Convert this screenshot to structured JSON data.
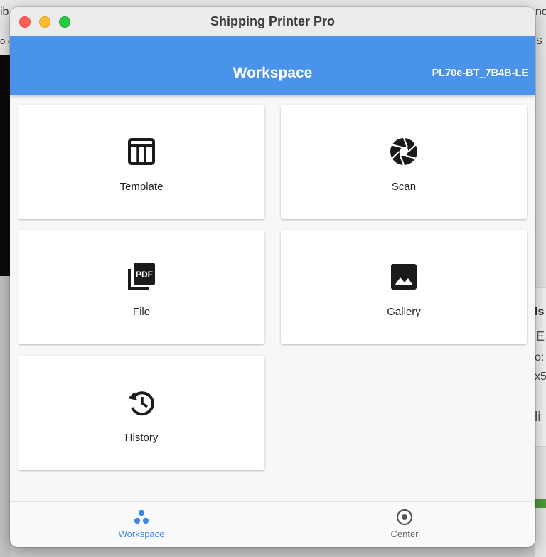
{
  "window": {
    "title": "Shipping Printer Pro"
  },
  "appbar": {
    "title": "Workspace",
    "device_name": "PL70e-BT_7B4B-LE"
  },
  "tiles": [
    {
      "label": "Template",
      "icon": "template-icon"
    },
    {
      "label": "Scan",
      "icon": "camera-shutter-icon"
    },
    {
      "label": "File",
      "icon": "pdf-file-icon"
    },
    {
      "label": "Gallery",
      "icon": "image-icon"
    },
    {
      "label": "History",
      "icon": "history-icon"
    }
  ],
  "bottom_nav": {
    "items": [
      {
        "label": "Workspace",
        "icon": "workspace-icon",
        "active": true
      },
      {
        "label": "Center",
        "icon": "target-icon",
        "active": false
      }
    ]
  },
  "background": {
    "fragments": [
      "ib",
      "nc",
      "o c",
      "S",
      "ls",
      "E",
      "o:",
      "x5",
      "li"
    ]
  },
  "colors": {
    "accent": "#4a93ea",
    "active_nav": "#3d8ae6",
    "inactive_nav": "#666666",
    "icon": "#1a1a1a"
  }
}
